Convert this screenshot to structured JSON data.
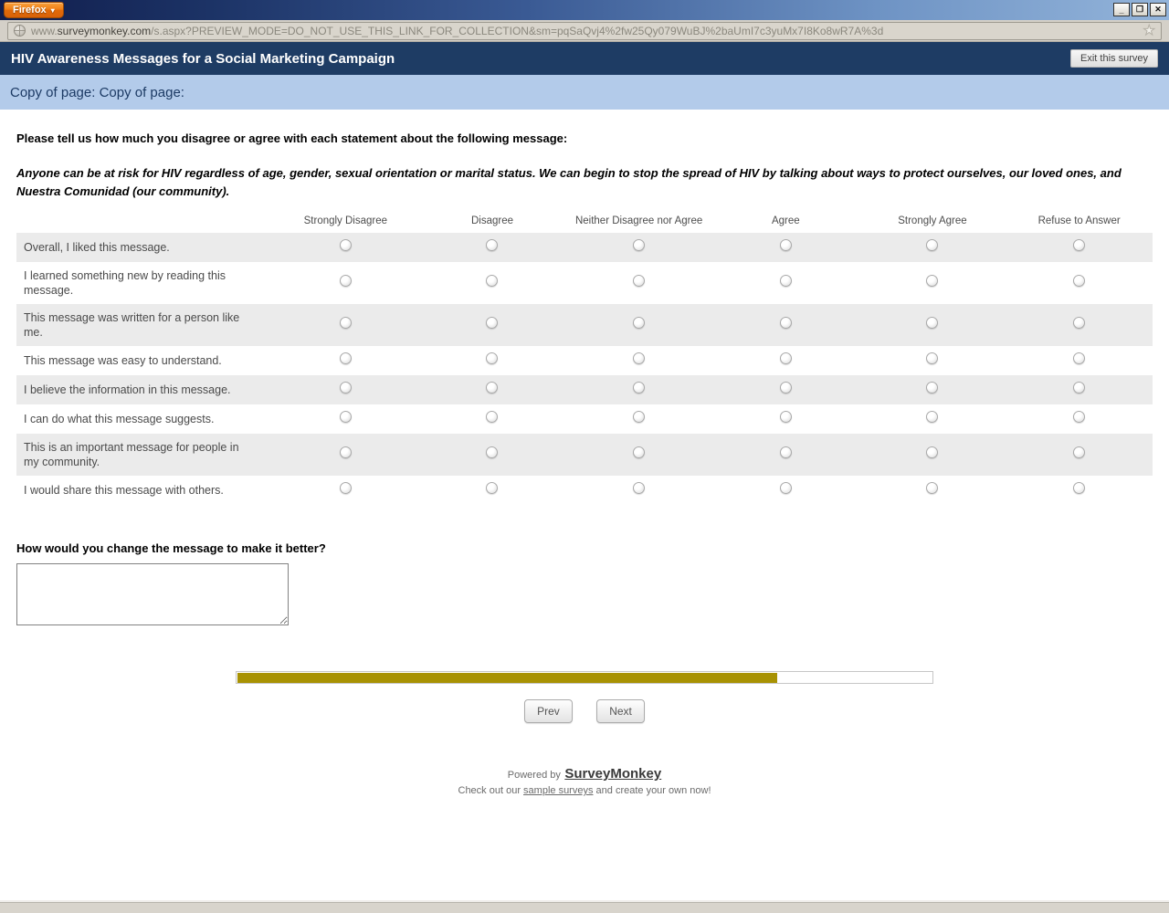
{
  "browser": {
    "firefox_button": "Firefox",
    "caret": "▾",
    "url_prefix": "www.",
    "url_domain": "surveymonkey.com",
    "url_path": "/s.aspx?PREVIEW_MODE=DO_NOT_USE_THIS_LINK_FOR_COLLECTION&sm=pqSaQvj4%2fw25Qy079WuBJ%2baUmI7c3yuMx7I8Ko8wR7A%3d",
    "star": "★",
    "window_controls": {
      "minimize": "_",
      "restore": "❐",
      "close": "✕"
    }
  },
  "survey": {
    "title": "HIV Awareness Messages for a Social Marketing Campaign",
    "exit_button": "Exit this survey",
    "page_label": "Copy of page: Copy of page:",
    "intro": "Please tell us how much you disagree or agree with each statement about the following message:",
    "message": "Anyone can be at risk for HIV regardless of age, gender, sexual orientation or marital status. We can begin to stop the spread of HIV by talking about ways to protect ourselves, our loved ones, and Nuestra Comunidad (our community).",
    "matrix": {
      "columns": [
        "Strongly Disagree",
        "Disagree",
        "Neither Disagree nor Agree",
        "Agree",
        "Strongly Agree",
        "Refuse to Answer"
      ],
      "rows": [
        "Overall, I liked this message.",
        "I learned something new by reading this message.",
        "This message was written for a person like me.",
        "This message was easy to understand.",
        "I believe the information in this message.",
        "I can do what this message suggests.",
        "This is an important message for people in my community.",
        "I would share this message with others."
      ]
    },
    "open_question": "How would you change the message to make it better?",
    "comment_value": "",
    "progress_percent": 77.5,
    "prev_button": "Prev",
    "next_button": "Next"
  },
  "footer": {
    "powered_by": "Powered by",
    "brand": "SurveyMonkey",
    "line2_prefix": "Check out our",
    "sample_link": "sample surveys",
    "line2_suffix": "and create your own now!"
  },
  "colors": {
    "banner_navy": "#1e3c64",
    "subbanner_blue": "#b3cbea",
    "progress_gold": "#a89203",
    "firefox_orange": "#ef7f18",
    "shaded_row": "#ebebeb"
  }
}
